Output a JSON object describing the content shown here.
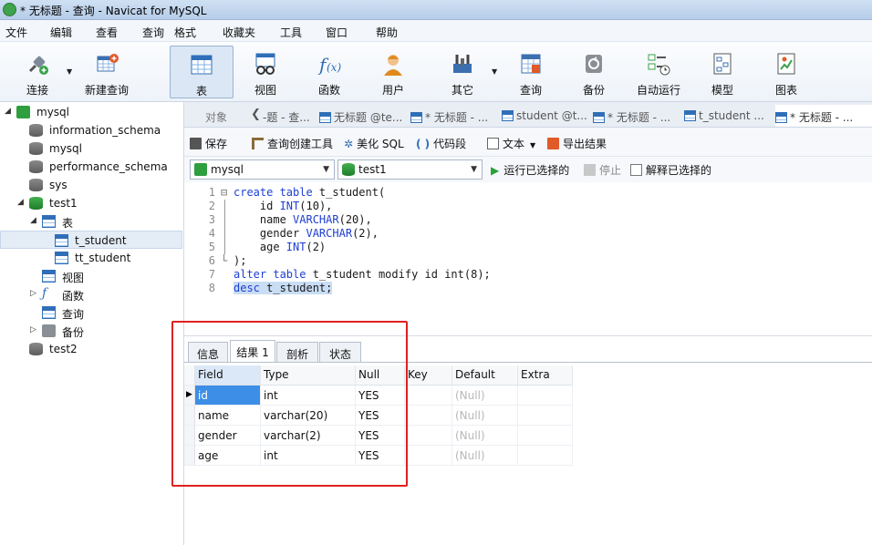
{
  "window": {
    "title": "* 无标题 - 查询 - Navicat for MySQL"
  },
  "menu": [
    "文件",
    "编辑",
    "查看",
    "查询",
    "格式",
    "收藏夹",
    "工具",
    "窗口",
    "帮助"
  ],
  "toolbar": {
    "connect": "连接",
    "new_query": "新建查询",
    "table": "表",
    "view": "视图",
    "function": "函数",
    "user": "用户",
    "other": "其它",
    "query": "查询",
    "backup": "备份",
    "autorun": "自动运行",
    "model": "模型",
    "chart": "图表"
  },
  "tree": {
    "root": "mysql",
    "dbs": [
      "information_schema",
      "mysql",
      "performance_schema",
      "sys"
    ],
    "test1": "test1",
    "tables_folder": "表",
    "tables": [
      "t_student",
      "tt_student"
    ],
    "views": "视图",
    "functions": "函数",
    "queries": "查询",
    "backups": "备份",
    "test2": "test2"
  },
  "tabs": {
    "object": "对象",
    "items": [
      "-题 - 查...",
      "无标题 @te...",
      "* 无标题 - ...",
      "student @t...",
      "* 无标题 - ...",
      "t_student ...",
      "* 无标题 - ..."
    ]
  },
  "query_toolbar": {
    "save": "保存",
    "builder": "查询创建工具",
    "beautify": "美化 SQL",
    "snippet": "代码段",
    "text": "文本",
    "export": "导出结果"
  },
  "selectors": {
    "connection": "mysql",
    "database": "test1",
    "run_selected": "运行已选择的",
    "stop": "停止",
    "explain": "解释已选择的"
  },
  "editor": {
    "lines": [
      {
        "n": "1",
        "fold": "⊟",
        "pre": "",
        "kw": "create table",
        "post": " t_student("
      },
      {
        "n": "2",
        "fold": "",
        "pre": "    id ",
        "kw": "INT",
        "post": "(10),"
      },
      {
        "n": "3",
        "fold": "",
        "pre": "    name ",
        "kw": "VARCHAR",
        "post": "(20),"
      },
      {
        "n": "4",
        "fold": "",
        "pre": "    gender ",
        "kw": "VARCHAR",
        "post": "(2),"
      },
      {
        "n": "5",
        "fold": "",
        "pre": "    age ",
        "kw": "INT",
        "post": "(2)"
      },
      {
        "n": "6",
        "fold": "└",
        "pre": ");",
        "kw": "",
        "post": ""
      },
      {
        "n": "7",
        "fold": "",
        "pre": "",
        "kw": "alter table",
        "post": " t_student modify id int(8);"
      },
      {
        "n": "8",
        "fold": "",
        "pre": "",
        "kw": "desc",
        "post": " t_student;"
      }
    ]
  },
  "result": {
    "tabs": [
      "信息",
      "结果 1",
      "剖析",
      "状态"
    ],
    "columns": [
      "Field",
      "Type",
      "Null",
      "Key",
      "Default",
      "Extra"
    ],
    "rows": [
      [
        "id",
        "int",
        "YES",
        "",
        "(Null)",
        ""
      ],
      [
        "name",
        "varchar(20)",
        "YES",
        "",
        "(Null)",
        ""
      ],
      [
        "gender",
        "varchar(2)",
        "YES",
        "",
        "(Null)",
        ""
      ],
      [
        "age",
        "int",
        "YES",
        "",
        "(Null)",
        ""
      ]
    ]
  },
  "colors": {
    "highlight_box": "#e02020",
    "selection": "#3d8ee6",
    "keyword": "#1f3fd1"
  }
}
